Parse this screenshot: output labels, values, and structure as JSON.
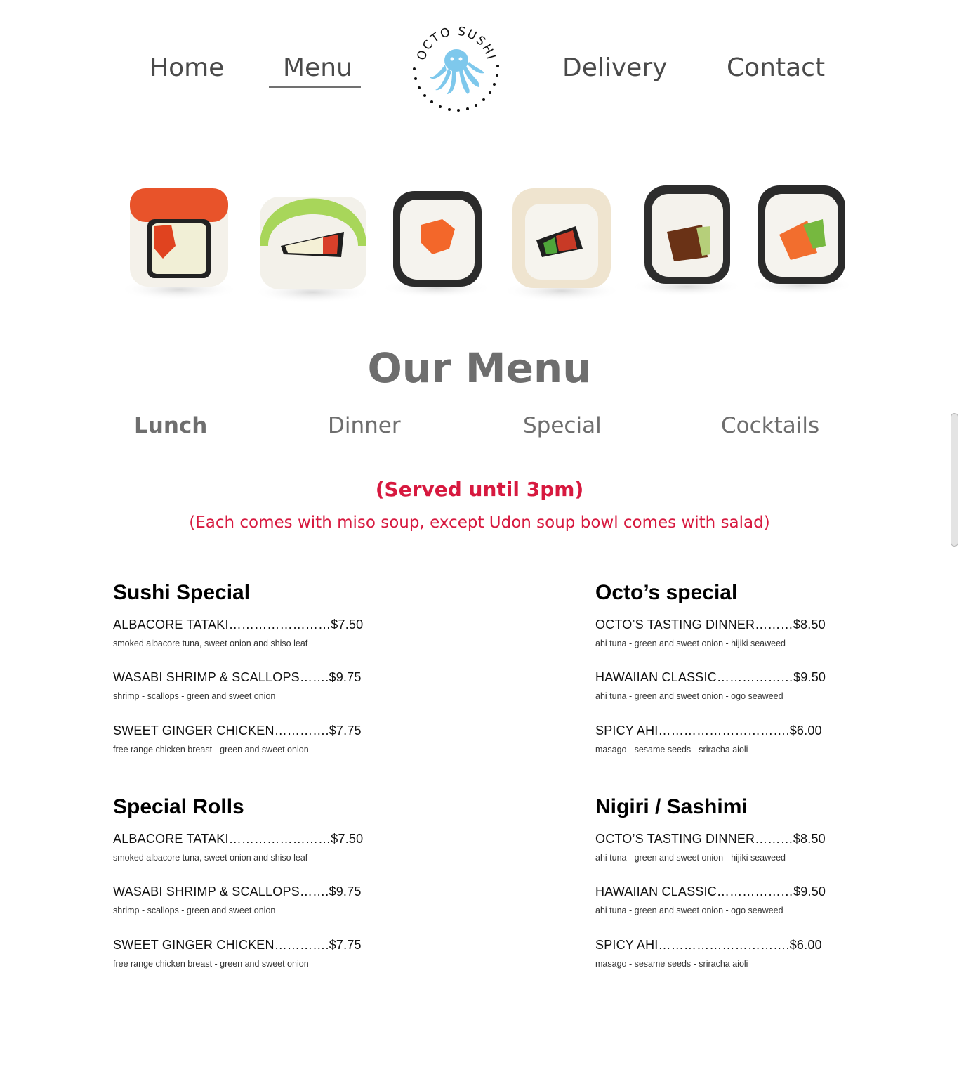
{
  "nav": {
    "home": "Home",
    "menu": "Menu",
    "delivery": "Delivery",
    "contact": "Contact",
    "logo_text": "OCTO SUSHI",
    "logo_icon": "octopus-icon",
    "active": "Menu"
  },
  "title": "Our Menu",
  "tabs": [
    {
      "label": "Lunch",
      "active": true
    },
    {
      "label": "Dinner",
      "active": false
    },
    {
      "label": "Special",
      "active": false
    },
    {
      "label": "Cocktails",
      "active": false
    }
  ],
  "notice": {
    "served": "(Served until 3pm)",
    "includes": "(Each comes with miso soup, except Udon soup bowl comes with salad)"
  },
  "sections": [
    {
      "title": "Sushi Special",
      "items": [
        {
          "name": "ALBACORE TATAKI……………………$7.50",
          "desc": "smoked albacore tuna, sweet onion and shiso leaf"
        },
        {
          "name": "WASABI SHRIMP & SCALLOPS…….$9.75",
          "desc": "shrimp - scallops - green and sweet onion"
        },
        {
          "name": "SWEET GINGER CHICKEN………….$7.75",
          "desc": "free range chicken breast - green and sweet onion"
        }
      ]
    },
    {
      "title": "Octo’s special",
      "items": [
        {
          "name": "OCTO’S TASTING DINNER………$8.50",
          "desc": "ahi tuna - green and sweet onion - hijiki seaweed"
        },
        {
          "name": "HAWAIIAN CLASSIC………………$9.50",
          "desc": "ahi tuna - green and sweet onion - ogo seaweed"
        },
        {
          "name": "SPICY AHI………………………….$6.00",
          "desc": "masago - sesame seeds - sriracha aioli"
        }
      ]
    },
    {
      "title": "Special Rolls",
      "items": [
        {
          "name": "ALBACORE TATAKI……………………$7.50",
          "desc": "smoked albacore tuna, sweet onion and shiso leaf"
        },
        {
          "name": "WASABI SHRIMP & SCALLOPS…….$9.75",
          "desc": "shrimp - scallops - green and sweet onion"
        },
        {
          "name": "SWEET GINGER CHICKEN………….$7.75",
          "desc": "free range chicken breast - green and sweet onion"
        }
      ]
    },
    {
      "title": "Nigiri / Sashimi",
      "items": [
        {
          "name": "OCTO’S TASTING DINNER………$8.50",
          "desc": "ahi tuna - green and sweet onion - hijiki seaweed"
        },
        {
          "name": "HAWAIIAN CLASSIC………………$9.50",
          "desc": "ahi tuna - green and sweet onion - ogo seaweed"
        },
        {
          "name": "SPICY AHI………………………….$6.00",
          "desc": "masago - sesame seeds - sriracha aioli"
        }
      ]
    }
  ],
  "colors": {
    "nav_text": "#4a4a4a",
    "heading_gray": "#6e6e6e",
    "notice_red": "#d7193f",
    "logo_blue": "#7ec8ec"
  },
  "hero_image": "sushi-rolls-row"
}
